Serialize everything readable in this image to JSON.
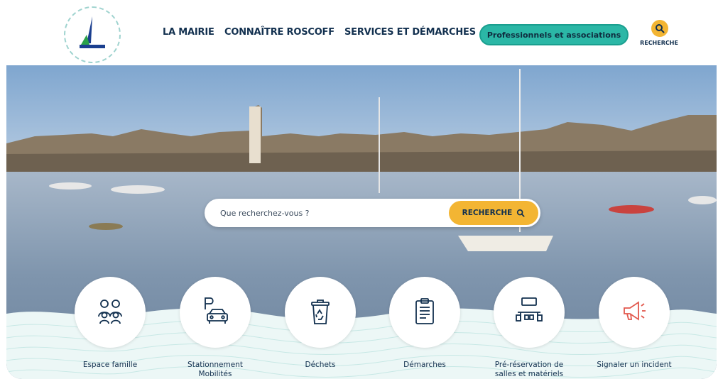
{
  "header": {
    "logo_alt": "ROSCOFF",
    "nav": [
      {
        "label": "LA MAIRIE"
      },
      {
        "label": "CONNAÎTRE ROSCOFF"
      },
      {
        "label": "SERVICES ET DÉMARCHES"
      }
    ],
    "pro_button": "Professionnels et associations",
    "search_label": "RECHERCHE"
  },
  "hero": {
    "search_placeholder": "Que recherchez-vous ?",
    "search_button": "RECHERCHE"
  },
  "quick_links": [
    {
      "label": "Espace famille",
      "icon": "family-icon"
    },
    {
      "label": "Stationnement\nMobilités",
      "icon": "parking-car-icon"
    },
    {
      "label": "Déchets",
      "icon": "recycle-bin-icon"
    },
    {
      "label": "Démarches",
      "icon": "clipboard-icon"
    },
    {
      "label": "Pré-réservation de\nsalles et matériels",
      "icon": "meeting-room-icon"
    },
    {
      "label": "Signaler un incident",
      "icon": "megaphone-icon"
    }
  ],
  "colors": {
    "navy": "#12304f",
    "teal": "#2bb7a6",
    "yellow": "#f3b533",
    "wave": "#d9f0ee"
  }
}
